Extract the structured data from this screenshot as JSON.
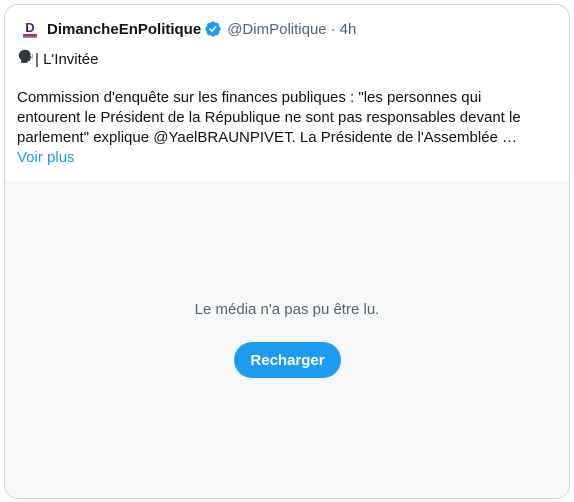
{
  "tweet": {
    "author_name": "DimancheEnPolitique",
    "handle": "@DimPolitique",
    "separator": "·",
    "time": "4h",
    "avatar_letter": "D",
    "show_icon_glyph": "🗣️",
    "show_name": "| L'Invitée",
    "text": "Commission d'enquête sur les finances publiques : \"les personnes qui entourent le Président de la République ne sont pas responsables devant le parlement\" explique @YaelBRAUNPIVET. La Présidente de l'Assemblée …",
    "show_more": "Voir plus"
  },
  "media": {
    "error_text": "Le média n'a pas pu être lu.",
    "reload_label": "Recharger"
  },
  "colors": {
    "accent": "#1d9bf0",
    "verified": "#1d9bf0",
    "muted_text": "#536471",
    "media_bg": "#f7f9f9"
  },
  "icons": {
    "avatar": "dimanche-en-politique-logo",
    "verified": "verified-badge-icon",
    "show": "speaking-head-icon"
  }
}
